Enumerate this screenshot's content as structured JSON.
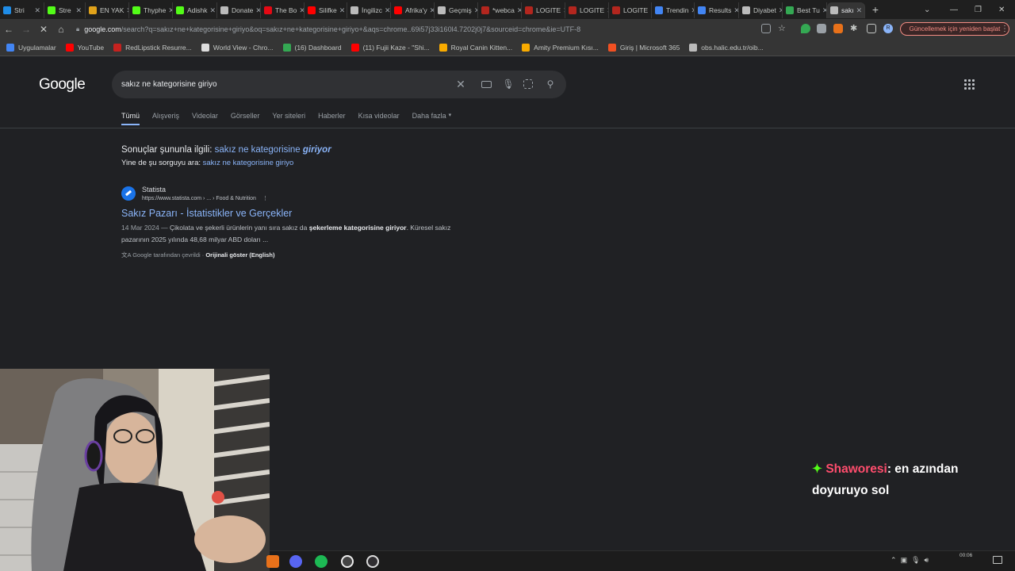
{
  "browser": {
    "tabs": [
      {
        "label": "Stri",
        "color": "#1f8ce6"
      },
      {
        "label": "Stre",
        "color": "#53fc18"
      },
      {
        "label": "EN YAK",
        "color": "#e0a21a"
      },
      {
        "label": "Thyphe",
        "color": "#53fc18"
      },
      {
        "label": "Adishk",
        "color": "#53fc18"
      },
      {
        "label": "Donate",
        "color": "#bbbbbb"
      },
      {
        "label": "The Bo",
        "color": "#e50914"
      },
      {
        "label": "Silifke",
        "color": "#ff0000"
      },
      {
        "label": "İngilizc",
        "color": "#bbbbbb"
      },
      {
        "label": "Afrika'y",
        "color": "#ff0000"
      },
      {
        "label": "Geçmiş",
        "color": "#bbbbbb"
      },
      {
        "label": "*webca",
        "color": "#b3261e"
      },
      {
        "label": "LOGITE",
        "color": "#b3261e"
      },
      {
        "label": "LOGITE",
        "color": "#b3261e"
      },
      {
        "label": "LOGITE",
        "color": "#b3261e"
      },
      {
        "label": "Trendin",
        "color": "#4285f4"
      },
      {
        "label": "Results",
        "color": "#4285f4"
      },
      {
        "label": "Diyabet",
        "color": "#bbbbbb"
      },
      {
        "label": "Best Tu",
        "color": "#34a853"
      },
      {
        "label": "sakı",
        "color": "#bbbbbb"
      }
    ],
    "url_domain": "google.com",
    "url_rest": "/search?q=sakız+ne+kategorisine+giriyo&oq=sakız+ne+kategorisine+giriyo+&aqs=chrome..69i57j33i160l4.7202j0j7&sourceid=chrome&ie=UTF-8",
    "update_label": "Güncellemek için yeniden başlat",
    "profile_letter": "R",
    "bookmarks": [
      {
        "label": "Uygulamalar",
        "color": "#4285f4"
      },
      {
        "label": "YouTube",
        "color": "#ff0000"
      },
      {
        "label": "RedLipstick Resurre...",
        "color": "#c5221f"
      },
      {
        "label": "World View - Chro...",
        "color": "#dddddd"
      },
      {
        "label": "(16) Dashboard",
        "color": "#34a853"
      },
      {
        "label": "(11) Fujii Kaze - \"Shi...",
        "color": "#ff0000"
      },
      {
        "label": "Royal Canin Kitten...",
        "color": "#f9ab00"
      },
      {
        "label": "Amity Premium Kısı...",
        "color": "#f9ab00"
      },
      {
        "label": "Giriş | Microsoft 365",
        "color": "#f25022"
      },
      {
        "label": "obs.halic.edu.tr/oib...",
        "color": "#bbbbbb"
      }
    ]
  },
  "google": {
    "logo": "Google",
    "query": "sakız ne kategorisine giriyo",
    "filters": [
      "Tümü",
      "Alışveriş",
      "Videolar",
      "Görseller",
      "Yer siteleri",
      "Haberler",
      "Kısa videolar",
      "Daha fazla"
    ],
    "correction_prefix": "Sonuçlar şununla ilgili:",
    "correction_text": "sakız ne kategorisine",
    "correction_bold": "giriyor",
    "original_prefix": "Yine de şu sorguyu ara:",
    "original_query": "sakız ne kategorisine giriyo",
    "result": {
      "site_name": "Statista",
      "site_url": "https://www.statista.com › ... › Food & Nutrition",
      "title": "Sakız Pazarı - İstatistikler ve Gerçekler",
      "snippet_date": "14 Mar 2024 —",
      "snippet_a": "Çikolata ve şekerli ürünlerin yanı sıra sakız da",
      "snippet_bold": "şekerleme kategorisine giriyor",
      "snippet_b": ". Küresel sakız pazarının 2025 yılında 48,68 milyar ABD doları ...",
      "translated_by": "Google tarafından çevrildi ·",
      "show_original": "Orijinali göster (English)"
    }
  },
  "stream": {
    "chat_user": "Shaworesi",
    "chat_message": ": en azından doyuruyo sol"
  },
  "taskbar": {
    "clock_time": "00:06"
  }
}
